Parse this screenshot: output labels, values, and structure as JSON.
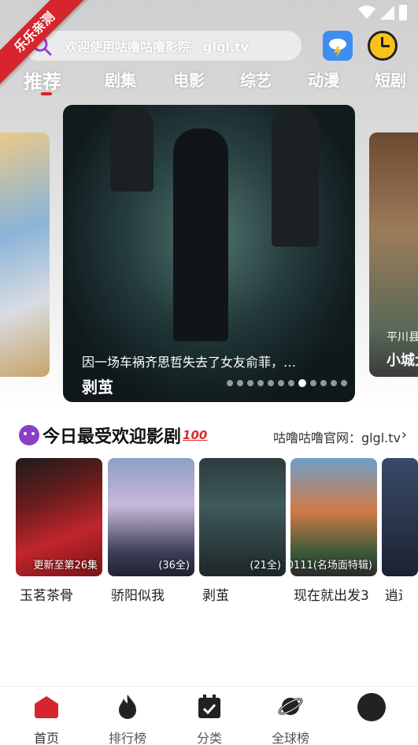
{
  "ribbon": "乐乐亲测",
  "search": {
    "placeholder": "欢迎使用咕噜咕噜影院：glgl.tv"
  },
  "tabs": [
    "推荐",
    "剧集",
    "电影",
    "综艺",
    "动漫",
    "短剧"
  ],
  "active_tab": 0,
  "carousel": {
    "main": {
      "caption": "因一场车祸齐思哲失去了女友俞菲，…",
      "title": "剥茧"
    },
    "right": {
      "caption": "平川县",
      "title": "小城大"
    },
    "dot_count": 12,
    "active_dot": 7
  },
  "section": {
    "title": "今日最受欢迎影剧",
    "hundred": "100",
    "link": "咕噜咕噜官网：glgl.tv",
    "chevron": "›"
  },
  "posters": [
    {
      "name": "玉茗茶骨",
      "badge": "更新至第26集"
    },
    {
      "name": "骄阳似我",
      "badge": "(36全)"
    },
    {
      "name": "剥茧",
      "badge": "(21全)"
    },
    {
      "name": "现在就出发3",
      "badge": "0111(名场面特辑)"
    },
    {
      "name": "逍遥",
      "badge": ""
    }
  ],
  "nav": [
    {
      "label": "首页",
      "icon": "home-icon",
      "active": true
    },
    {
      "label": "排行榜",
      "icon": "flame-icon",
      "active": false
    },
    {
      "label": "分类",
      "icon": "calendar-check-icon",
      "active": false
    },
    {
      "label": "全球榜",
      "icon": "planet-icon",
      "active": false
    },
    {
      "label": "",
      "icon": "avatar-icon",
      "active": false
    }
  ],
  "colors": {
    "accent": "#d6252c",
    "weather": "#3d8ef0",
    "clock": "#f7c21c"
  }
}
